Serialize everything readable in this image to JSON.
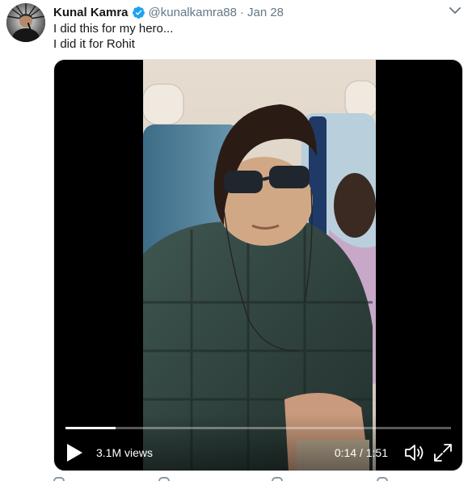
{
  "author": {
    "display_name": "Kunal Kamra",
    "handle": "@kunalkamra88",
    "separator": "·",
    "date": "Jan 28",
    "verified": true,
    "avatar_icon": "avatar"
  },
  "tweet": {
    "lines": [
      "I did this for my hero...",
      "I did it for Rohit"
    ]
  },
  "video": {
    "views": "3.1M views",
    "timecode": "0:14 / 1:51",
    "progress": 0.13,
    "icons": {
      "play": "play-icon",
      "volume": "volume-icon",
      "fullscreen": "fullscreen-icon",
      "menu": "chevron-down-icon",
      "verified": "verified-badge-icon"
    }
  },
  "colors": {
    "name": "#14171a",
    "secondary": "#657786",
    "verified": "#1da1f2",
    "media_bg": "#000000"
  }
}
